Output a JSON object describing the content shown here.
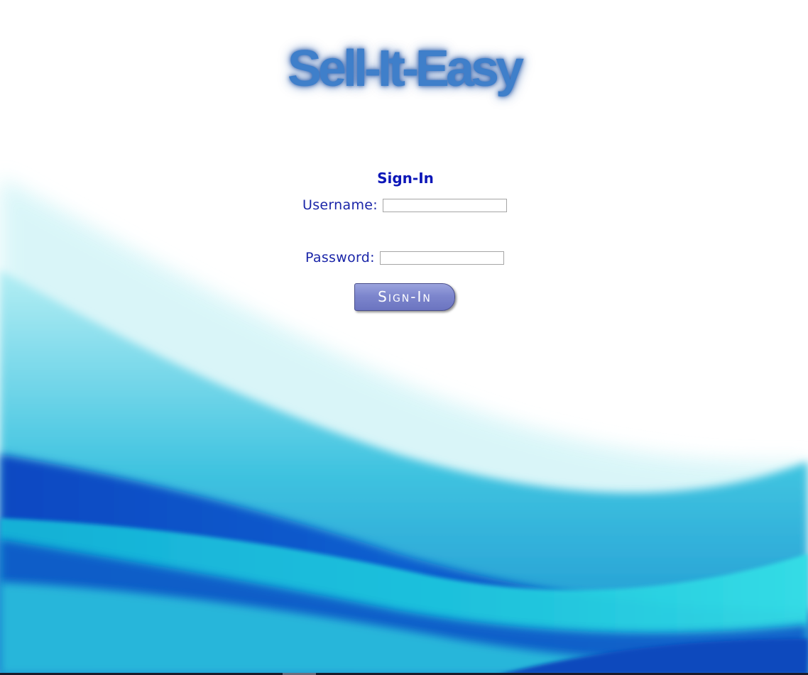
{
  "app": {
    "logo_text": "Sell-It-Easy"
  },
  "signin_form": {
    "title": "Sign-In",
    "username_label": "Username:",
    "username_value": "",
    "password_label": "Password:",
    "password_value": "",
    "submit_label": "Sign-In"
  },
  "colors": {
    "logo": "#3f7fca",
    "form_text": "#0d17b8",
    "button": "#7d86cd",
    "wave_dark": "#0a3fb3",
    "wave_light": "#2fd6e0"
  }
}
